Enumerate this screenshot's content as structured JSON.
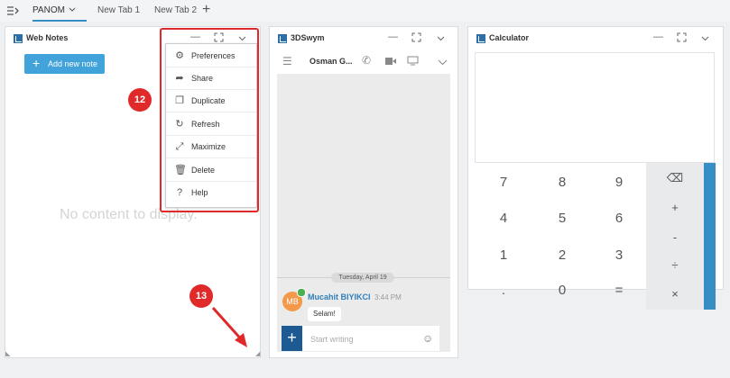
{
  "tabs": [
    {
      "label": "PANOM"
    },
    {
      "label": "New Tab 1"
    },
    {
      "label": "New Tab 2"
    }
  ],
  "icons": {
    "menu": "sidebar-toggle-icon",
    "add_tab": "plus-icon",
    "chevron": "chevron-down-icon"
  },
  "webnotes": {
    "title": "Web Notes",
    "add_button": "Add new note",
    "empty": "No content to display.",
    "menu": [
      "Preferences",
      "Share",
      "Duplicate",
      "Refresh",
      "Maximize",
      "Delete",
      "Help"
    ]
  },
  "callouts": {
    "a": "12",
    "b": "13"
  },
  "swym": {
    "title": "3DSwym",
    "contact": "Osman G...",
    "date": "Tuesday, April 19",
    "avatar": "MB",
    "user": "Mucahit BIYIKCI",
    "time": "3:44 PM",
    "message": "Selam!",
    "placeholder": "Start writing"
  },
  "calculator": {
    "title": "Calculator",
    "keys": [
      "7",
      "8",
      "9",
      "4",
      "5",
      "6",
      "1",
      "2",
      "3",
      ".",
      "0",
      "="
    ],
    "ops": [
      "⌫",
      "+",
      "-",
      "÷",
      "×"
    ]
  },
  "colors": {
    "accent": "#368ec4",
    "button": "#42a2da",
    "callout": "#e02a2a"
  }
}
